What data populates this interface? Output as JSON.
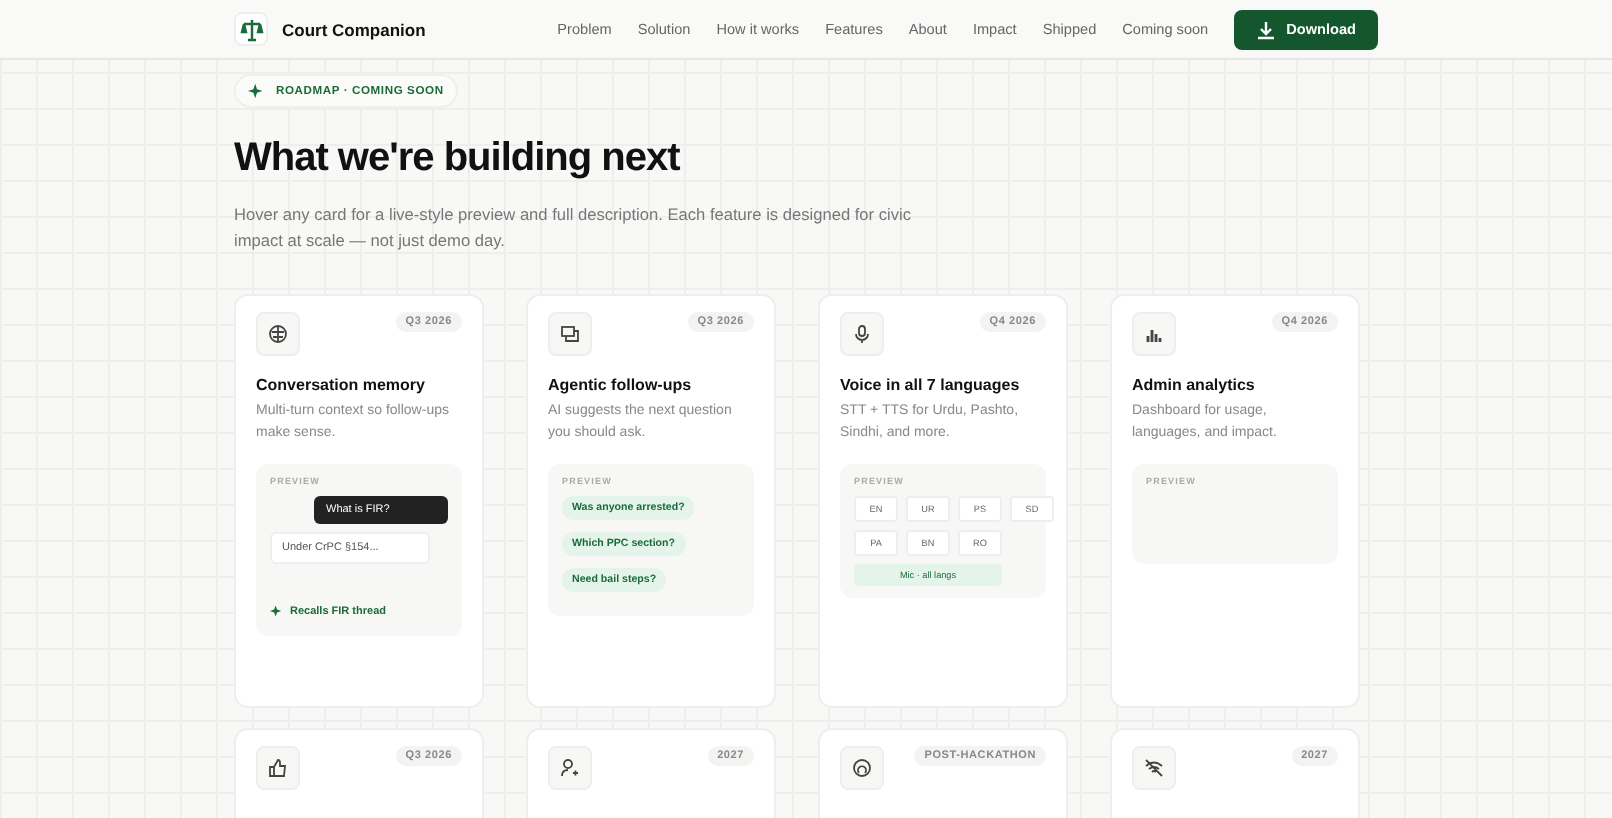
{
  "nav": {
    "brand": "Court Companion",
    "links": [
      "Problem",
      "Solution",
      "How it works",
      "Features",
      "About",
      "Impact",
      "Shipped",
      "Coming soon"
    ],
    "download": "Download"
  },
  "hero": {
    "badge": "ROADMAP · COMING SOON",
    "title": "What we're building next",
    "subtitle": "Hover any card for a live-style preview and full description. Each feature is designed for civic impact at scale — not just demo day."
  },
  "cards": [
    {
      "tag": "Q3 2026",
      "title": "Conversation memory",
      "description": "Multi-turn context so follow-ups make sense.",
      "preview": {
        "label": "PREVIEW",
        "kind": "chat",
        "question": "What is FIR?",
        "answer": "Under CrPC §154...",
        "note": "Recalls FIR thread"
      }
    },
    {
      "tag": "Q3 2026",
      "title": "Agentic follow-ups",
      "description": "AI suggests the next question you should ask.",
      "preview": {
        "label": "PREVIEW",
        "kind": "chips",
        "chips": [
          "Was anyone arrested?",
          "Which PPC section?",
          "Need bail steps?"
        ]
      }
    },
    {
      "tag": "Q4 2026",
      "title": "Voice in all 7 languages",
      "description": "STT + TTS for Urdu, Pashto, Sindhi, and more.",
      "preview": {
        "label": "PREVIEW",
        "kind": "langs",
        "langs": [
          "EN",
          "UR",
          "PS",
          "SD",
          "PA",
          "BN",
          "RO"
        ],
        "mic": "Mic · all langs"
      }
    },
    {
      "tag": "Q4 2026",
      "title": "Admin analytics",
      "description": "Dashboard for usage, languages, and impact.",
      "preview": {
        "label": "PREVIEW",
        "kind": "empty"
      }
    },
    {
      "tag": "Q3 2026"
    },
    {
      "tag": "2027"
    },
    {
      "tag": "POST-HACKATHON"
    },
    {
      "tag": "2027"
    }
  ]
}
